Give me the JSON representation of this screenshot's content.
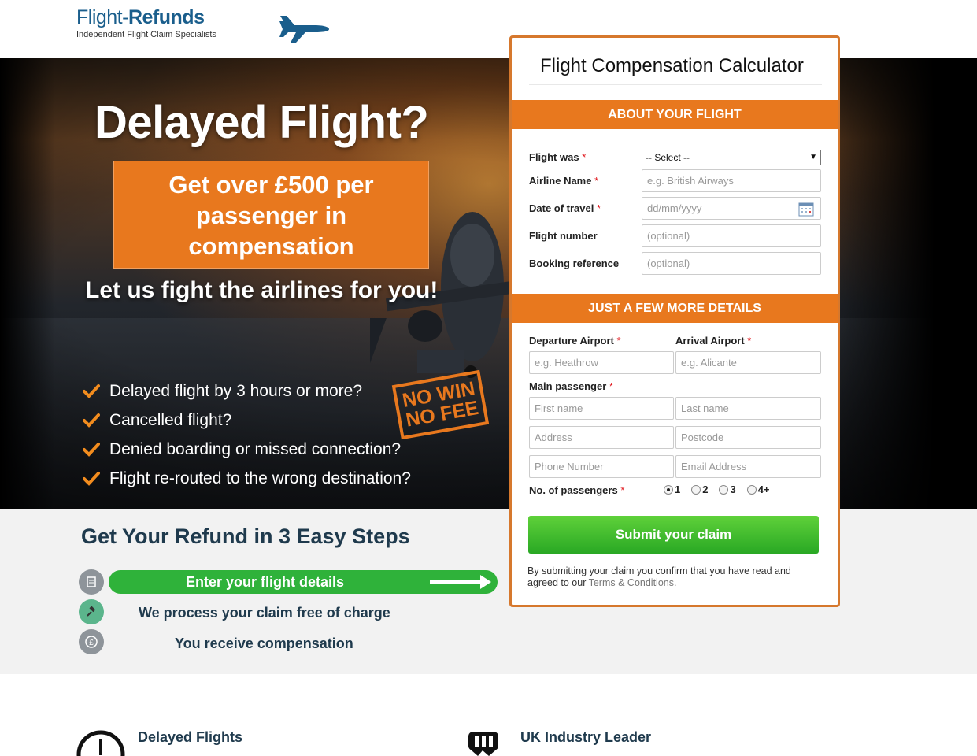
{
  "brand": {
    "name_light": "Flight-",
    "name_bold": "Refunds",
    "tagline": "Independent Flight Claim Specialists"
  },
  "hero": {
    "title": "Delayed Flight?",
    "offer_lines": [
      "Get over £500 per",
      "passenger in",
      "compensation"
    ],
    "subtitle": "Let us fight the airlines for you!",
    "checks": [
      "Delayed flight by 3 hours or more?",
      "Cancelled flight?",
      "Denied boarding or missed connection?",
      "Flight re-routed to the wrong destination?"
    ],
    "stamp_lines": [
      "NO WIN",
      "NO FEE"
    ]
  },
  "steps": {
    "title": "Get Your Refund in 3 Easy Steps",
    "items": [
      {
        "label": "Enter your flight details",
        "icon": "form-icon"
      },
      {
        "label": "We process your claim free of charge",
        "icon": "gavel-icon"
      },
      {
        "label": "You receive compensation",
        "icon": "pound-coin-icon"
      }
    ]
  },
  "features": [
    {
      "title": "Delayed Flights",
      "icon": "clock-icon"
    },
    {
      "title": "UK Industry Leader",
      "icon": "ribbon-icon"
    }
  ],
  "form": {
    "title": "Flight Compensation Calculator",
    "section1": "ABOUT YOUR FLIGHT",
    "section2": "JUST A FEW MORE DETAILS",
    "required_mark": "*",
    "fields": {
      "flight_was": {
        "label": "Flight was",
        "value": "-- Select --"
      },
      "airline": {
        "label": "Airline Name",
        "placeholder": "e.g. British Airways"
      },
      "date": {
        "label": "Date of travel",
        "placeholder": "dd/mm/yyyy"
      },
      "flight_number": {
        "label": "Flight number",
        "placeholder": "(optional)"
      },
      "booking_ref": {
        "label": "Booking reference",
        "placeholder": "(optional)"
      },
      "departure": {
        "label": "Departure Airport",
        "placeholder": "e.g. Heathrow"
      },
      "arrival": {
        "label": "Arrival Airport",
        "placeholder": "e.g. Alicante"
      },
      "main_passenger": {
        "label": "Main passenger"
      },
      "first_name": {
        "placeholder": "First name"
      },
      "last_name": {
        "placeholder": "Last name"
      },
      "address": {
        "placeholder": "Address"
      },
      "postcode": {
        "placeholder": "Postcode"
      },
      "phone": {
        "placeholder": "Phone Number"
      },
      "email": {
        "placeholder": "Email Address"
      },
      "passengers": {
        "label": "No. of passengers",
        "options": [
          "1",
          "2",
          "3",
          "4+"
        ],
        "selected": "1"
      }
    },
    "submit": "Submit your claim",
    "disclaimer": "By submitting your claim you confirm that you have read and agreed to our",
    "terms_link": "Terms & Conditions."
  },
  "colors": {
    "accent_orange": "#e8781e",
    "brand_navy": "#1f3a4d",
    "submit_green": "#2fb23a"
  }
}
